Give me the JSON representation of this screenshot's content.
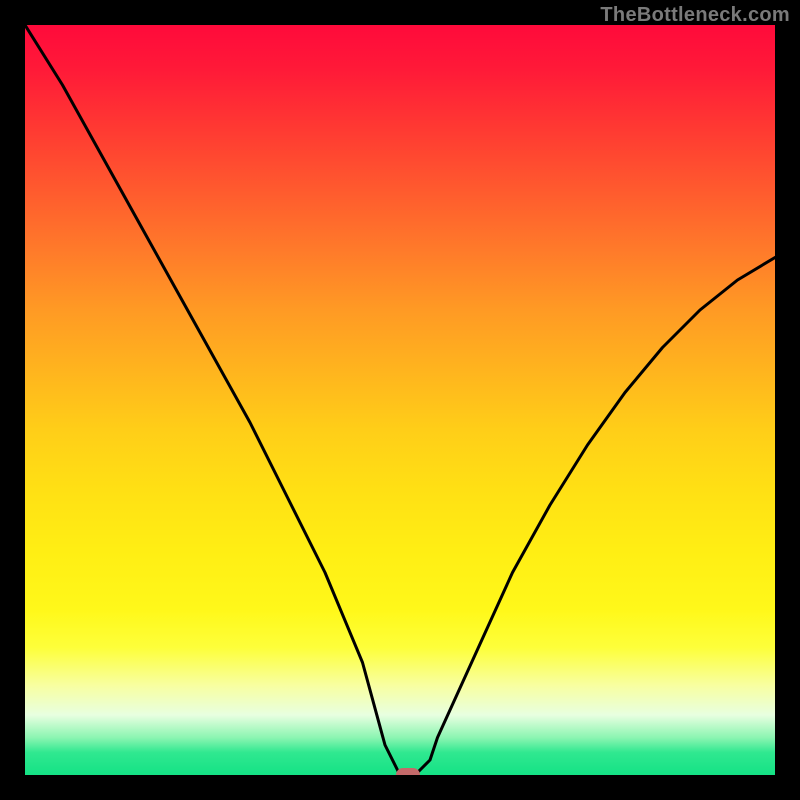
{
  "watermark": "TheBottleneck.com",
  "chart_data": {
    "type": "line",
    "title": "",
    "xlabel": "",
    "ylabel": "",
    "xlim": [
      0,
      100
    ],
    "ylim": [
      0,
      100
    ],
    "grid": false,
    "legend": false,
    "series": [
      {
        "name": "curve",
        "x": [
          0,
          5,
          10,
          15,
          20,
          25,
          30,
          35,
          40,
          45,
          48,
          50,
          52,
          54,
          55,
          60,
          65,
          70,
          75,
          80,
          85,
          90,
          95,
          100
        ],
        "values": [
          100,
          92,
          83,
          74,
          65,
          56,
          47,
          37,
          27,
          15,
          4,
          0,
          0,
          2,
          5,
          16,
          27,
          36,
          44,
          51,
          57,
          62,
          66,
          69
        ]
      }
    ],
    "marker": {
      "x": 51,
      "y": 0
    },
    "background_gradient_stops": [
      {
        "pos": 0,
        "color": "#ff0a3b"
      },
      {
        "pos": 50,
        "color": "#ffce18"
      },
      {
        "pos": 85,
        "color": "#fdff3a"
      },
      {
        "pos": 100,
        "color": "#14e285"
      }
    ]
  }
}
